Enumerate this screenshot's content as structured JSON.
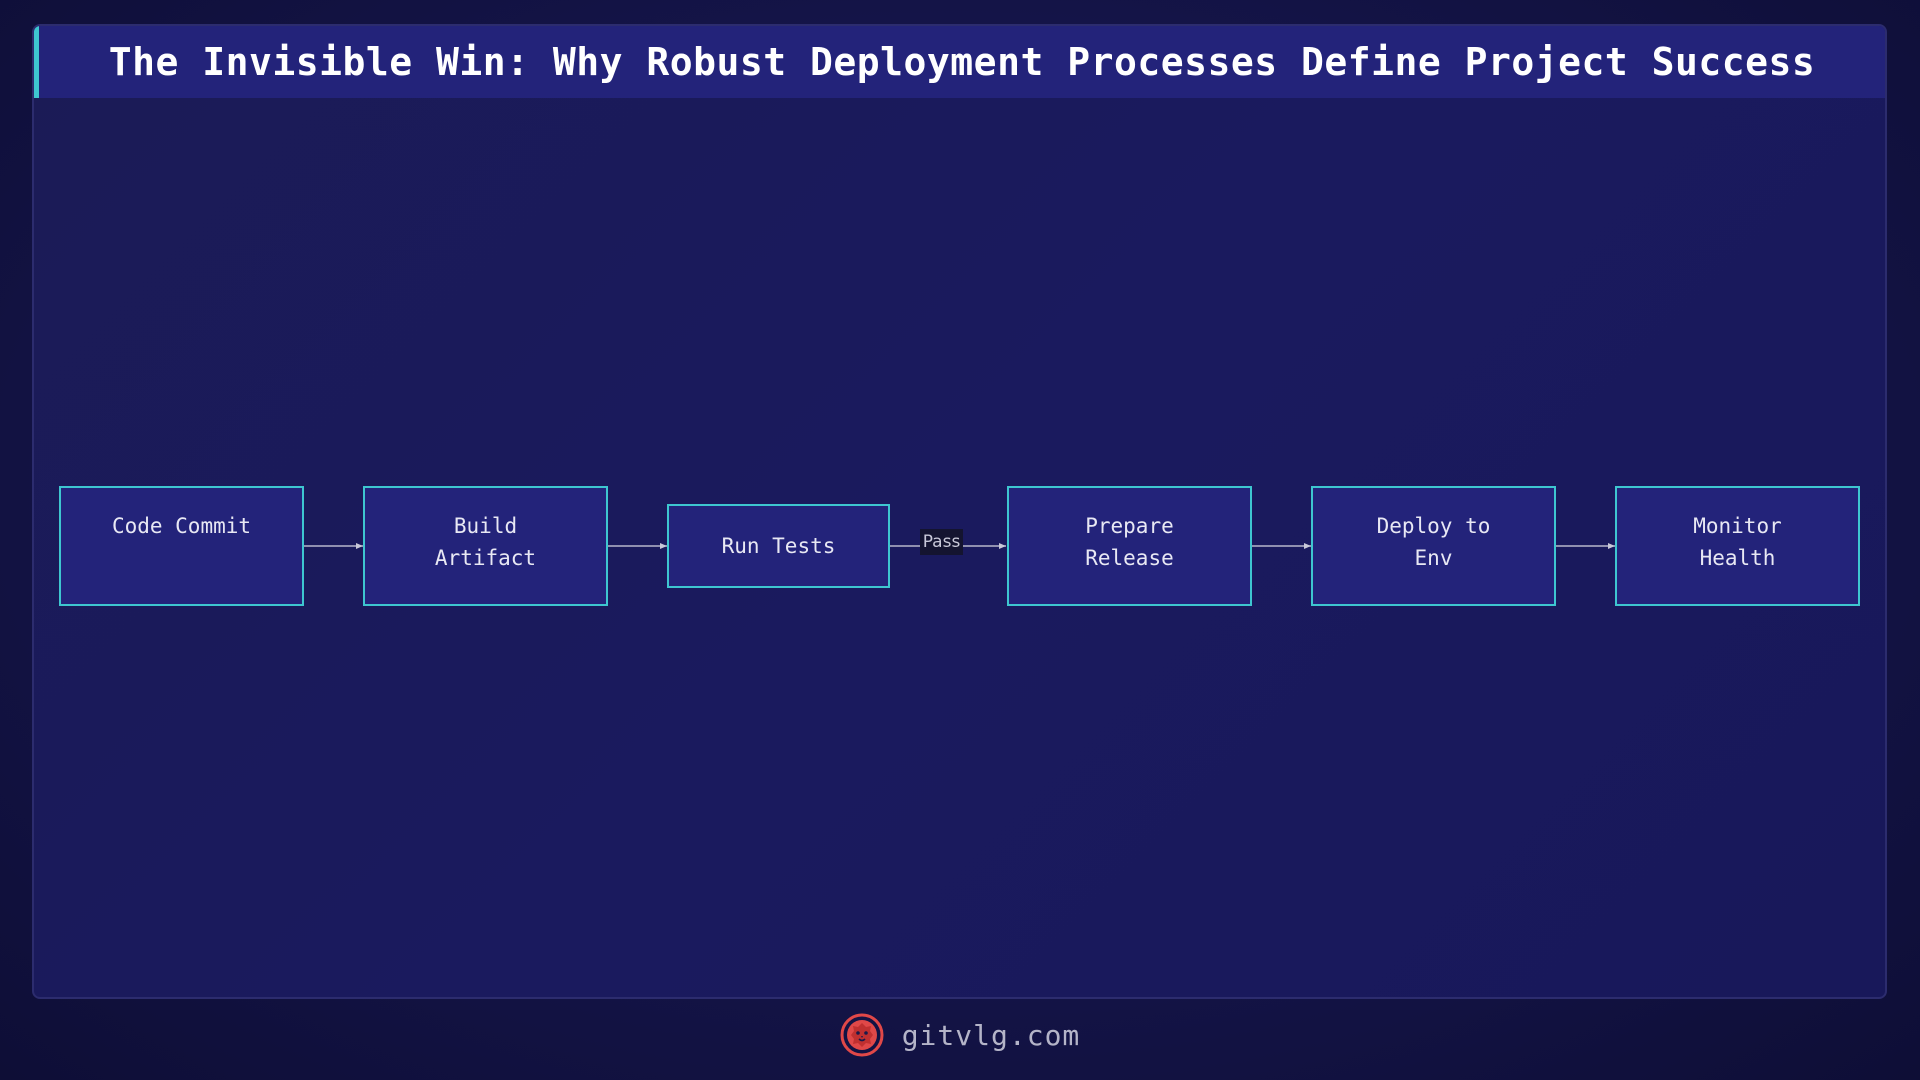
{
  "title": "The Invisible Win: Why Robust Deployment Processes Define Project Success",
  "diagram": {
    "nodes": [
      {
        "id": "code-commit",
        "label": "Code Commit"
      },
      {
        "id": "build-artifact",
        "label": "Build\n Artifact"
      },
      {
        "id": "run-tests",
        "label": "Run Tests"
      },
      {
        "id": "prepare-release",
        "label": "Prepare\n Release"
      },
      {
        "id": "deploy-to-env",
        "label": "Deploy to\n Env"
      },
      {
        "id": "monitor-health",
        "label": "Monitor\n Health"
      }
    ],
    "edges": [
      {
        "from": "code-commit",
        "to": "build-artifact",
        "label": ""
      },
      {
        "from": "build-artifact",
        "to": "run-tests",
        "label": ""
      },
      {
        "from": "run-tests",
        "to": "prepare-release",
        "label": "Pass"
      },
      {
        "from": "prepare-release",
        "to": "deploy-to-env",
        "label": ""
      },
      {
        "from": "deploy-to-env",
        "to": "monitor-health",
        "label": ""
      }
    ]
  },
  "footer": {
    "site": "gitvlg.com",
    "logo_icon": "lion-head-icon"
  },
  "colors": {
    "background": "#141448",
    "title_bar": "#23237a",
    "accent": "#3ec6d0",
    "node_fill": "#23237a",
    "logo": "#e04848"
  }
}
